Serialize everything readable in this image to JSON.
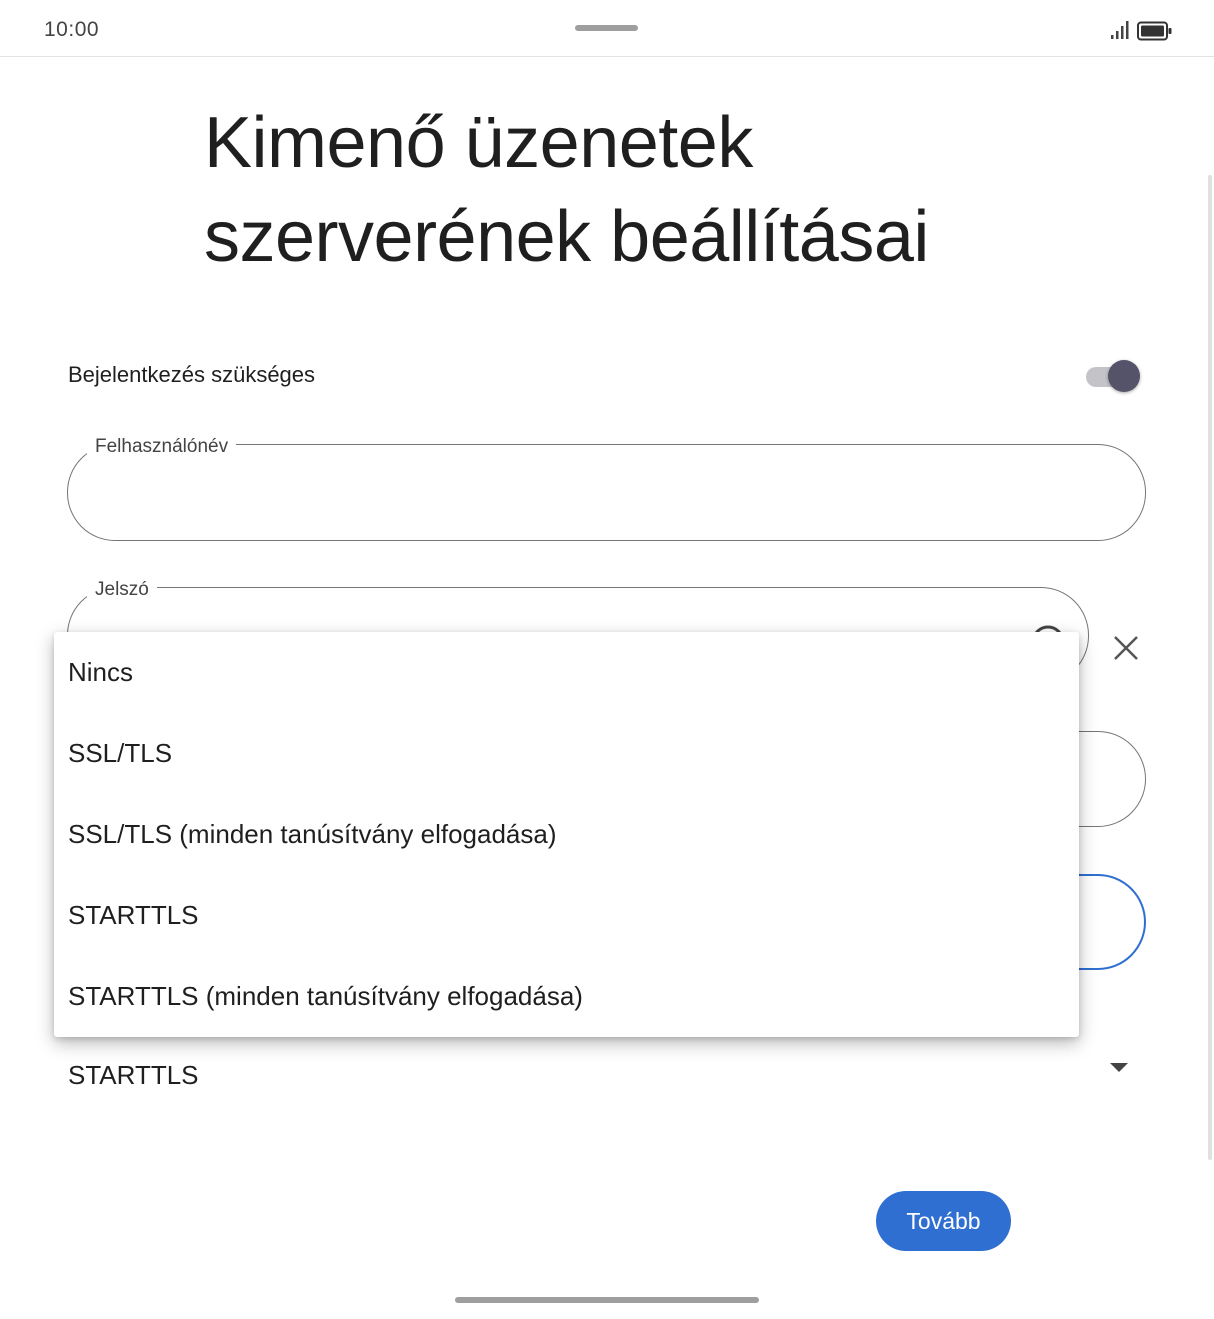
{
  "status_bar": {
    "time": "10:00"
  },
  "page": {
    "title": "Kimenő üzenetek szerverének beállításai"
  },
  "login_toggle": {
    "label": "Bejelentkezés szükséges",
    "enabled": true
  },
  "fields": {
    "username_label": "Felhasználónév",
    "password_label": "Jelszó"
  },
  "security_menu": {
    "options": [
      "Nincs",
      "SSL/TLS",
      "SSL/TLS (minden tanúsítvány elfogadása)",
      "STARTTLS",
      "STARTTLS (minden tanúsítvány elfogadása)"
    ],
    "selected": "STARTTLS"
  },
  "actions": {
    "next_label": "Tovább"
  },
  "colors": {
    "primary": "#2f6fd1",
    "toggle_thumb": "#54536a",
    "toggle_track": "#c4c4c8"
  },
  "icons": [
    "signal-icon",
    "battery-icon",
    "eye-icon",
    "clear-icon",
    "dropdown-arrow-icon"
  ]
}
